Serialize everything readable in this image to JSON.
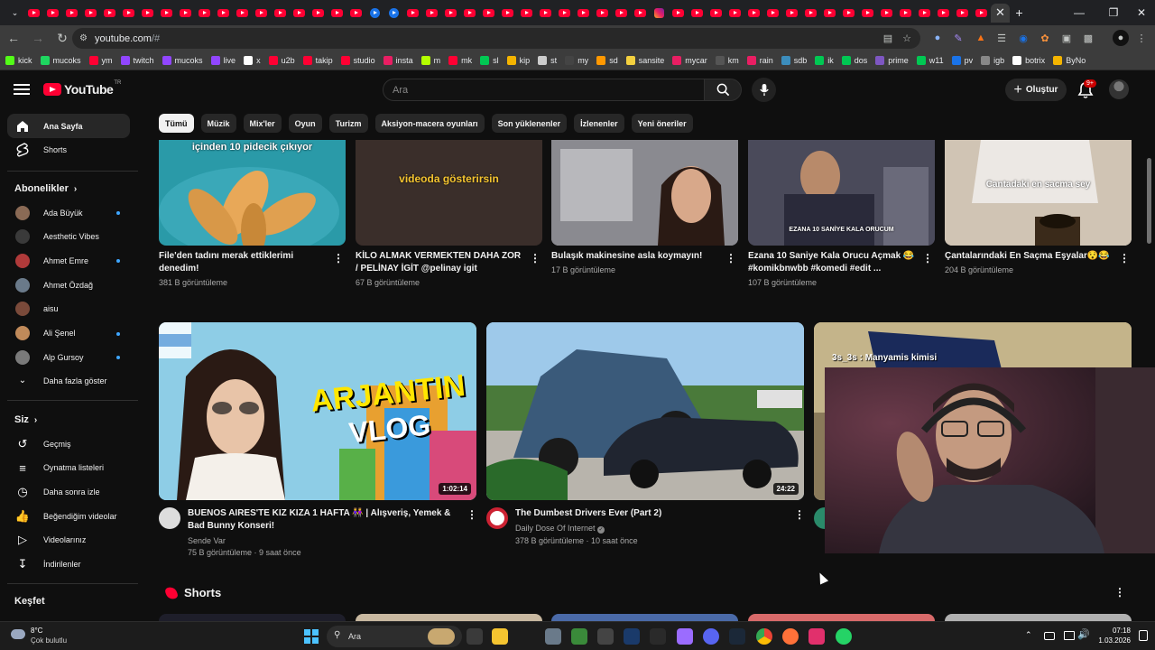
{
  "browser": {
    "url_host": "youtube.com",
    "url_path": "/#",
    "bookmarks": [
      {
        "label": "kick",
        "color": "#53fc18"
      },
      {
        "label": "mucoks",
        "color": "#1ed760"
      },
      {
        "label": "ym",
        "color": "#ff0033"
      },
      {
        "label": "twitch",
        "color": "#9146ff"
      },
      {
        "label": "mucoks",
        "color": "#9146ff"
      },
      {
        "label": "live",
        "color": "#9146ff"
      },
      {
        "label": "x",
        "color": "#ffffff"
      },
      {
        "label": "u2b",
        "color": "#ff0033"
      },
      {
        "label": "takip",
        "color": "#ff0033"
      },
      {
        "label": "studio",
        "color": "#ff0033"
      },
      {
        "label": "insta",
        "color": "#e91e63"
      },
      {
        "label": "m",
        "color": "#b4ff00"
      },
      {
        "label": "mk",
        "color": "#ff0033"
      },
      {
        "label": "sl",
        "color": "#00c853"
      },
      {
        "label": "kip",
        "color": "#f4b400"
      },
      {
        "label": "st",
        "color": "#cccccc"
      },
      {
        "label": "my",
        "color": "#444444"
      },
      {
        "label": "sd",
        "color": "#ff9800"
      },
      {
        "label": "sansite",
        "color": "#f4d03f"
      },
      {
        "label": "mycar",
        "color": "#e91e63"
      },
      {
        "label": "km",
        "color": "#555555"
      },
      {
        "label": "rain",
        "color": "#e91e63"
      },
      {
        "label": "sdb",
        "color": "#3c8dbc"
      },
      {
        "label": "ik",
        "color": "#00c853"
      },
      {
        "label": "dos",
        "color": "#00c853"
      },
      {
        "label": "prime",
        "color": "#7e57c2"
      },
      {
        "label": "w11",
        "color": "#00c853"
      },
      {
        "label": "pv",
        "color": "#1a73e8"
      },
      {
        "label": "igb",
        "color": "#888888"
      },
      {
        "label": "botrix",
        "color": "#ffffff"
      },
      {
        "label": "ByNo",
        "color": "#f4b400"
      }
    ]
  },
  "header": {
    "logo_text": "YouTube",
    "logo_sup": "TR",
    "search_placeholder": "Ara",
    "create_label": "Oluştur",
    "notif_badge": "9+"
  },
  "sidebar": {
    "home": "Ana Sayfa",
    "shorts": "Shorts",
    "subs_title": "Abonelikler",
    "channels": [
      {
        "name": "Ada Büyük",
        "dot": true,
        "color": "#8a6a55"
      },
      {
        "name": "Aesthetic Vibes",
        "dot": false,
        "color": "#3a3a3a"
      },
      {
        "name": "Ahmet Emre",
        "dot": true,
        "color": "#b03a3a"
      },
      {
        "name": "Ahmet Özdağ",
        "dot": false,
        "color": "#6a7a8a"
      },
      {
        "name": "aisu",
        "dot": false,
        "color": "#7a4a3a"
      },
      {
        "name": "Ali Şenel",
        "dot": true,
        "color": "#c08a5a"
      },
      {
        "name": "Alp Gursoy",
        "dot": true,
        "color": "#7a7a7a"
      }
    ],
    "show_more": "Daha fazla göster",
    "you_title": "Siz",
    "you_items": [
      {
        "label": "Geçmiş",
        "icon": "history-icon"
      },
      {
        "label": "Oynatma listeleri",
        "icon": "playlists-icon"
      },
      {
        "label": "Daha sonra izle",
        "icon": "watch-later-icon"
      },
      {
        "label": "Beğendiğim videolar",
        "icon": "liked-icon"
      },
      {
        "label": "Videolarınız",
        "icon": "your-videos-icon"
      },
      {
        "label": "İndirilenler",
        "icon": "downloads-icon"
      }
    ],
    "explore_title": "Keşfet"
  },
  "chips": [
    "Tümü",
    "Müzik",
    "Mix'ler",
    "Oyun",
    "Turizm",
    "Aksiyon-macera oyunları",
    "Son yüklenenler",
    "İzlenenler",
    "Yeni öneriler"
  ],
  "row1": [
    {
      "title": "File'den tadını merak ettiklerimi denedim!",
      "meta": "381 B görüntüleme",
      "overlay": "içinden 10 pidecik çıkıyor",
      "bg": "#2a9aa8"
    },
    {
      "title": "KİLO ALMAK VERMEKTEN DAHA ZOR / PELİNAY İGİT @pelinay igit",
      "meta": "67 B görüntüleme",
      "overlay": "videoda gösterirsin",
      "bg": "#3a2e2a"
    },
    {
      "title": "Bulaşık makinesine asla koymayın!",
      "meta": "17 B görüntüleme",
      "overlay": "",
      "bg": "#9a9aa0"
    },
    {
      "title": "Ezana 10 Saniye Kala Orucu Açmak 😂 #komikbnwbb #komedi #edit ...",
      "meta": "107 B görüntüleme",
      "overlay": "EZANA 10 SANİYE KALA ORUCUM",
      "bg": "#3a3040"
    },
    {
      "title": "Çantalarındaki En Saçma Eşyalar😯😂",
      "meta": "204 B görüntüleme",
      "overlay": "Cantadaki en sacma sey",
      "bg": "#d8ccc0"
    }
  ],
  "row2": [
    {
      "title": "BUENOS AIRES'TE KIZ KIZA 1 HAFTA 👭 | Alışveriş, Yemek & Bad Bunny Konseri!",
      "channel": "Sende Var",
      "meta": "75 B görüntüleme · 9 saat önce",
      "duration": "1:02:14",
      "thumb_text_1": "ARJANTIN",
      "thumb_text_2": "VLOG",
      "av_color": "#dddddd"
    },
    {
      "title": "The Dumbest Drivers Ever (Part 2)",
      "channel": "Daily Dose Of Internet",
      "meta": "378 B görüntüleme · 10 saat önce",
      "duration": "24:22",
      "av_color": "#cc2233"
    },
    {
      "overlay": "3s_3s : Manyamis kimisi",
      "av_color": "#2a8a6a"
    }
  ],
  "shorts_title": "Shorts",
  "taskbar": {
    "temp": "8°C",
    "weather": "Çok bulutlu",
    "search": "Ara",
    "time": "07:18",
    "date": "1.03.2026"
  }
}
